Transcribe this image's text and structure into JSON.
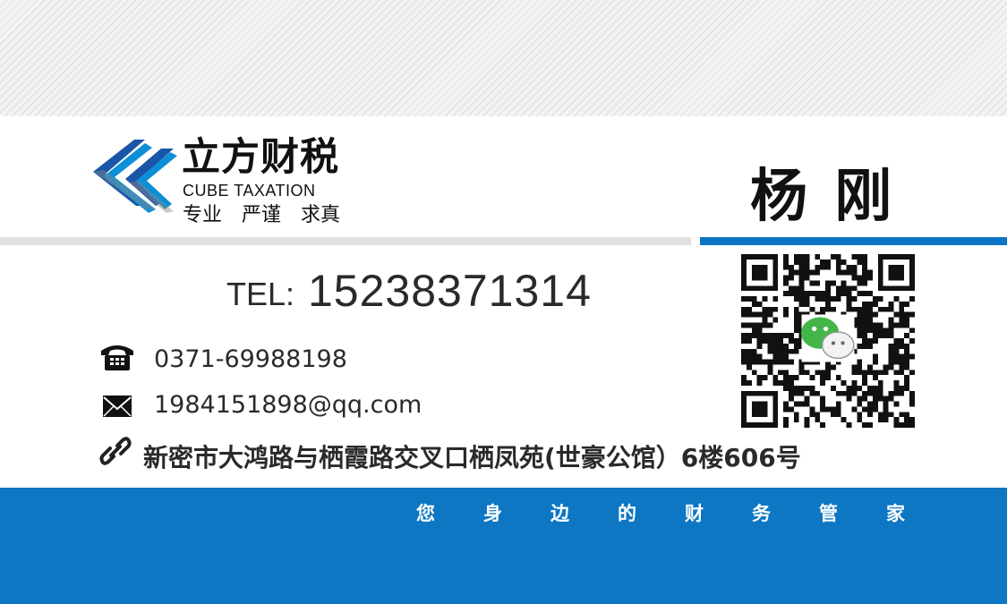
{
  "brand": {
    "name_cn": "立方财税",
    "name_en": "CUBE TAXATION",
    "tagline": "专业  严谨  求真",
    "accent_color": "#0d77c4",
    "logo_icon": "cube-chevron-logo"
  },
  "person": {
    "name": "杨 刚"
  },
  "contact": {
    "tel_label": "TEL:",
    "tel_number": "15238371314",
    "landline": "0371-69988198",
    "landline_icon": "telephone-icon",
    "email": "1984151898@qq.com",
    "email_icon": "envelope-icon",
    "address": "新密市大鸿路与栖霞路交叉口栖凤苑(世豪公馆）6楼606号",
    "address_icon": "link-icon"
  },
  "qr": {
    "icon": "wechat-icon"
  },
  "footer": {
    "slogan_chars": [
      "您",
      "身",
      "边",
      "的",
      "财",
      "务",
      "管",
      "家"
    ]
  }
}
